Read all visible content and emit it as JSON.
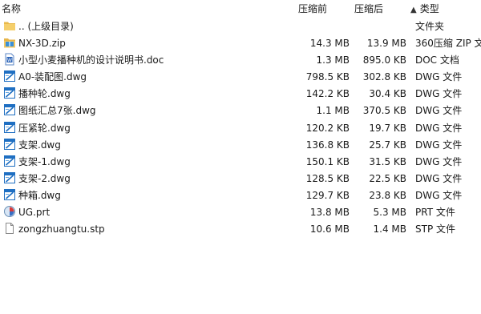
{
  "columns": {
    "name": "名称",
    "packed": "压缩前",
    "size": "压缩后",
    "type": "类型",
    "sort_arrow": "▲"
  },
  "files": [
    {
      "icon": "folder-up-icon",
      "name": ".. (上级目录)",
      "packed": "",
      "size": "",
      "type": "文件夹"
    },
    {
      "icon": "zip-archive-icon",
      "name": "NX-3D.zip",
      "packed": "14.3 MB",
      "size": "13.9 MB",
      "type": "360压缩 ZIP 文"
    },
    {
      "icon": "word-doc-icon",
      "name": "小型小麦播种机的设计说明书.doc",
      "packed": "1.3 MB",
      "size": "895.0 KB",
      "type": "DOC 文档"
    },
    {
      "icon": "dwg-file-icon",
      "name": "A0-装配图.dwg",
      "packed": "798.5 KB",
      "size": "302.8 KB",
      "type": "DWG 文件"
    },
    {
      "icon": "dwg-file-icon",
      "name": "播种轮.dwg",
      "packed": "142.2 KB",
      "size": "30.4 KB",
      "type": "DWG 文件"
    },
    {
      "icon": "dwg-file-icon",
      "name": "图纸汇总7张.dwg",
      "packed": "1.1 MB",
      "size": "370.5 KB",
      "type": "DWG 文件"
    },
    {
      "icon": "dwg-file-icon",
      "name": "压紧轮.dwg",
      "packed": "120.2 KB",
      "size": "19.7 KB",
      "type": "DWG 文件"
    },
    {
      "icon": "dwg-file-icon",
      "name": "支架.dwg",
      "packed": "136.8 KB",
      "size": "25.7 KB",
      "type": "DWG 文件"
    },
    {
      "icon": "dwg-file-icon",
      "name": "支架-1.dwg",
      "packed": "150.1 KB",
      "size": "31.5 KB",
      "type": "DWG 文件"
    },
    {
      "icon": "dwg-file-icon",
      "name": "支架-2.dwg",
      "packed": "128.5 KB",
      "size": "22.5 KB",
      "type": "DWG 文件"
    },
    {
      "icon": "dwg-file-icon",
      "name": "种箱.dwg",
      "packed": "129.7 KB",
      "size": "23.8 KB",
      "type": "DWG 文件"
    },
    {
      "icon": "ug-part-icon",
      "name": "UG.prt",
      "packed": "13.8 MB",
      "size": "5.3 MB",
      "type": "PRT 文件"
    },
    {
      "icon": "blank-file-icon",
      "name": "zongzhuangtu.stp",
      "packed": "10.6 MB",
      "size": "1.4 MB",
      "type": "STP 文件"
    }
  ]
}
